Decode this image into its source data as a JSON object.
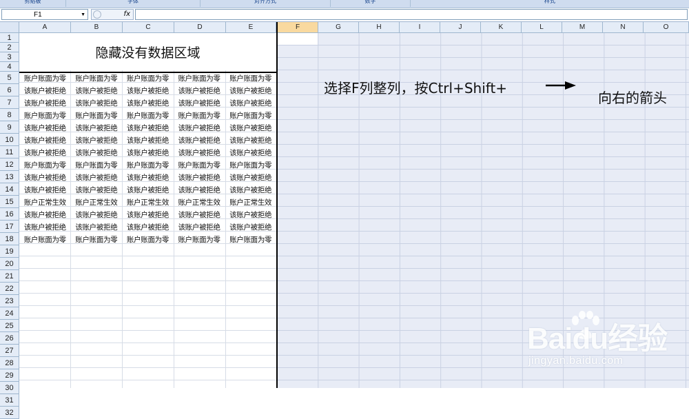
{
  "ribbon": {
    "groups": [
      "剪贴板",
      "字体",
      "对齐方式",
      "数字",
      "样式"
    ]
  },
  "formula_bar": {
    "name_box": "F1",
    "fx_label": "fx",
    "formula": ""
  },
  "columns": [
    "A",
    "B",
    "C",
    "D",
    "E",
    "F",
    "G",
    "H",
    "I",
    "J",
    "K",
    "L",
    "M",
    "N",
    "O"
  ],
  "selected_column": "F",
  "rows": [
    "1",
    "2",
    "3",
    "4",
    "5",
    "6",
    "7",
    "8",
    "9",
    "10",
    "11",
    "12",
    "13",
    "14",
    "15",
    "16",
    "17",
    "18",
    "19",
    "20",
    "21",
    "22",
    "23",
    "24",
    "25",
    "26",
    "27",
    "28",
    "29",
    "30",
    "31",
    "32"
  ],
  "sheet": {
    "title": "隐藏没有数据区域",
    "data_rows": [
      [
        "账户账面为零",
        "账户账面为零",
        "账户账面为零",
        "账户账面为零",
        "账户账面为零"
      ],
      [
        "该账户被拒绝",
        "该账户被拒绝",
        "该账户被拒绝",
        "该账户被拒绝",
        "该账户被拒绝"
      ],
      [
        "该账户被拒绝",
        "该账户被拒绝",
        "该账户被拒绝",
        "该账户被拒绝",
        "该账户被拒绝"
      ],
      [
        "账户账面为零",
        "账户账面为零",
        "账户账面为零",
        "账户账面为零",
        "账户账面为零"
      ],
      [
        "该账户被拒绝",
        "该账户被拒绝",
        "该账户被拒绝",
        "该账户被拒绝",
        "该账户被拒绝"
      ],
      [
        "该账户被拒绝",
        "该账户被拒绝",
        "该账户被拒绝",
        "该账户被拒绝",
        "该账户被拒绝"
      ],
      [
        "该账户被拒绝",
        "该账户被拒绝",
        "该账户被拒绝",
        "该账户被拒绝",
        "该账户被拒绝"
      ],
      [
        "账户账面为零",
        "账户账面为零",
        "账户账面为零",
        "账户账面为零",
        "账户账面为零"
      ],
      [
        "该账户被拒绝",
        "该账户被拒绝",
        "该账户被拒绝",
        "该账户被拒绝",
        "该账户被拒绝"
      ],
      [
        "该账户被拒绝",
        "该账户被拒绝",
        "该账户被拒绝",
        "该账户被拒绝",
        "该账户被拒绝"
      ],
      [
        "账户正常生效",
        "账户正常生效",
        "账户正常生效",
        "账户正常生效",
        "账户正常生效"
      ],
      [
        "该账户被拒绝",
        "该账户被拒绝",
        "该账户被拒绝",
        "该账户被拒绝",
        "该账户被拒绝"
      ],
      [
        "该账户被拒绝",
        "该账户被拒绝",
        "该账户被拒绝",
        "该账户被拒绝",
        "该账户被拒绝"
      ],
      [
        "账户账面为零",
        "账户账面为零",
        "账户账面为零",
        "账户账面为零",
        "账户账面为零"
      ]
    ]
  },
  "annotation": {
    "line1": "选择F列整列，按Ctrl+Shift+",
    "line2": "向右的箭头"
  },
  "watermark": {
    "logo": "Baidu经验",
    "url": "jingyan.baidu.com"
  },
  "colors": {
    "header_bg": "#e4ecf7",
    "selected_header": "#f9d99f",
    "hidden_area": "#e8ecf6"
  }
}
